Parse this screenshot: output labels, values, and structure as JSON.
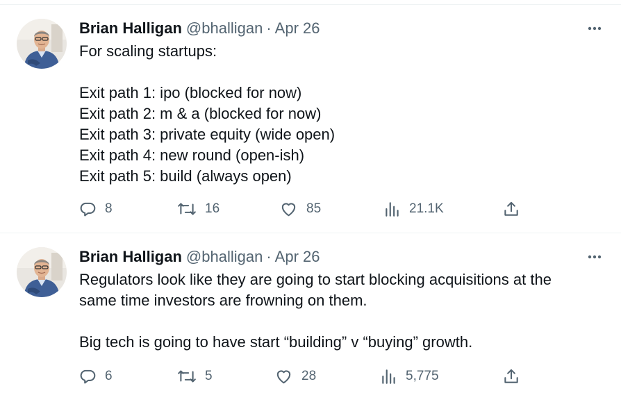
{
  "tweets": [
    {
      "author": {
        "name": "Brian Halligan",
        "handle": "@bhalligan"
      },
      "separator": "·",
      "date": "Apr 26",
      "lines": [
        "For scaling startups:",
        "",
        "Exit path 1:  ipo (blocked for now)",
        "Exit path 2:  m & a (blocked for now)",
        "Exit path 3:  private equity (wide open)",
        "Exit path 4:  new round (open-ish)",
        "Exit path 5:  build (always open)"
      ],
      "stats": {
        "replies": "8",
        "retweets": "16",
        "likes": "85",
        "views": "21.1K"
      }
    },
    {
      "author": {
        "name": "Brian Halligan",
        "handle": "@bhalligan"
      },
      "separator": "·",
      "date": "Apr 26",
      "lines": [
        "Regulators look like they are going to start blocking acquisitions at the",
        "same time investors are frowning on them.",
        "",
        "Big tech is going to have start “building” v “buying” growth."
      ],
      "stats": {
        "replies": "6",
        "retweets": "5",
        "likes": "28",
        "views": "5,775"
      }
    }
  ],
  "icons": {
    "reply": "reply-icon",
    "retweet": "retweet-icon",
    "like": "heart-icon",
    "views": "views-icon",
    "share": "share-icon",
    "more": "more-icon"
  },
  "colors": {
    "text": "#0f1419",
    "secondary": "#536471",
    "divider": "#eff3f4"
  }
}
